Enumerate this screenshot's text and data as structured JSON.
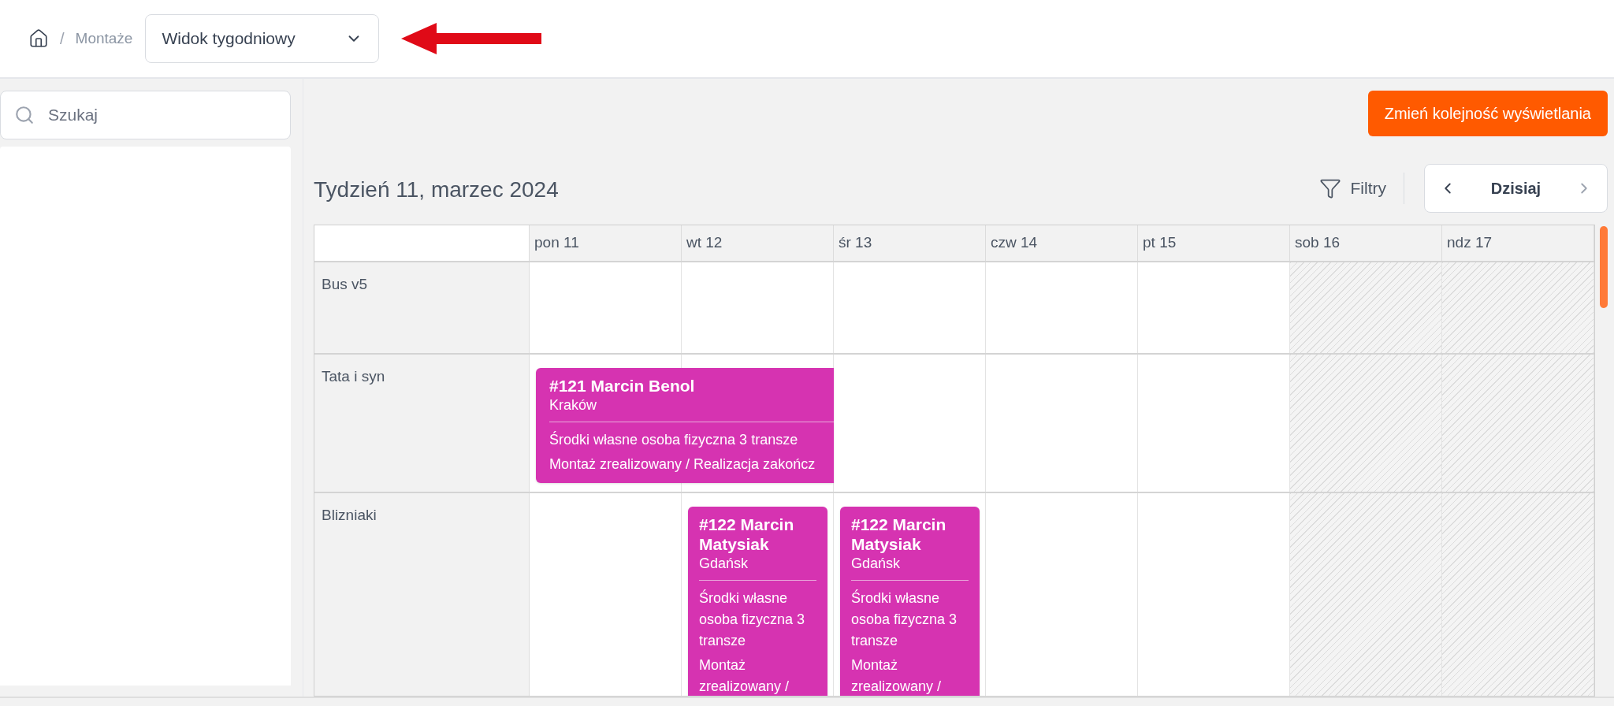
{
  "breadcrumb": {
    "separator": "/",
    "items": [
      "Montaże"
    ]
  },
  "view_select": {
    "value": "Widok tygodniowy"
  },
  "sidebar": {
    "search": {
      "placeholder": "Szukaj"
    }
  },
  "reorder_button": "Zmień kolejność wyświetlania",
  "calendar": {
    "title": "Tydzień 11, marzec 2024",
    "filters": "Filtry",
    "today": "Dzisiaj",
    "days": [
      {
        "label": "pon 11",
        "weekend": false
      },
      {
        "label": "wt 12",
        "weekend": false
      },
      {
        "label": "śr 13",
        "weekend": false
      },
      {
        "label": "czw 14",
        "weekend": false
      },
      {
        "label": "pt 15",
        "weekend": false
      },
      {
        "label": "sob 16",
        "weekend": true
      },
      {
        "label": "ndz 17",
        "weekend": true
      }
    ],
    "resources": [
      {
        "name": "Bus v5",
        "cells": [
          {
            "kind": "empty"
          },
          {
            "kind": "empty"
          },
          {
            "kind": "empty"
          },
          {
            "kind": "empty"
          },
          {
            "kind": "empty"
          },
          {
            "kind": "empty"
          },
          {
            "kind": "empty"
          }
        ]
      },
      {
        "name": "Tata i syn",
        "cells": [
          {
            "kind": "event",
            "continues": true,
            "title": "#121 Marcin Benol",
            "city": "Kraków",
            "details": [
              "Środki własne osoba fizyczna 3 transze",
              "Montaż zrealizowany / Realizacja zakończ"
            ]
          },
          {
            "kind": "empty"
          },
          {
            "kind": "empty"
          },
          {
            "kind": "empty"
          },
          {
            "kind": "empty"
          },
          {
            "kind": "empty"
          },
          {
            "kind": "empty"
          }
        ]
      },
      {
        "name": "Blizniaki",
        "cells": [
          {
            "kind": "empty"
          },
          {
            "kind": "event",
            "continues": false,
            "title": "#122 Marcin Matysiak",
            "city": "Gdańsk",
            "details": [
              "Środki własne osoba fizyczna 3 transze",
              "Montaż zrealizowany /"
            ]
          },
          {
            "kind": "event",
            "continues": false,
            "title": "#122 Marcin Matysiak",
            "city": "Gdańsk",
            "details": [
              "Środki własne osoba fizyczna 3 transze",
              "Montaż zrealizowany /"
            ]
          },
          {
            "kind": "empty"
          },
          {
            "kind": "empty"
          },
          {
            "kind": "empty"
          },
          {
            "kind": "empty"
          }
        ]
      }
    ]
  }
}
